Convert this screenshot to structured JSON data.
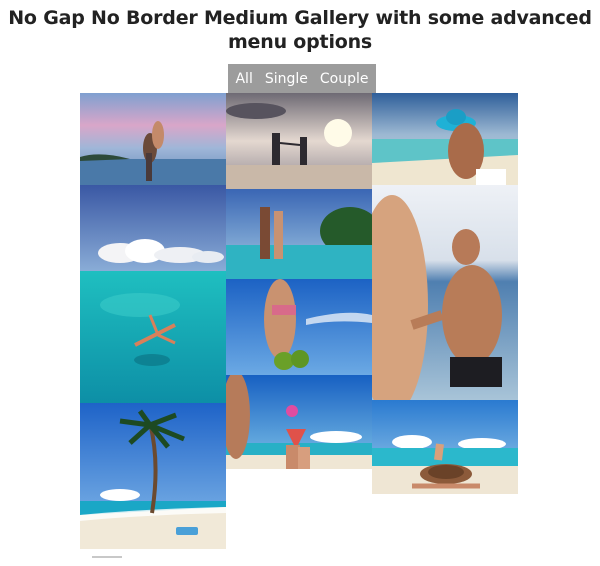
{
  "gallery": {
    "title": "No Gap No Border Medium Gallery with some advanced menu options",
    "filters": [
      "All",
      "Single",
      "Couple"
    ],
    "photos": [
      {
        "name": "couple-lifting-beach-sunset"
      },
      {
        "name": "couple-holding-hands-sunset"
      },
      {
        "name": "couple-blue-hat-beach"
      },
      {
        "name": "tropical-clouds-lagoon-swimmer"
      },
      {
        "name": "couple-kissing-palm-island"
      },
      {
        "name": "woman-holding-coconuts"
      },
      {
        "name": "man-reaching-hand-beach"
      },
      {
        "name": "palm-tree-beach-sunbather"
      },
      {
        "name": "cocktail-toast-beach"
      },
      {
        "name": "woman-sunhat-lying-beach"
      }
    ]
  }
}
